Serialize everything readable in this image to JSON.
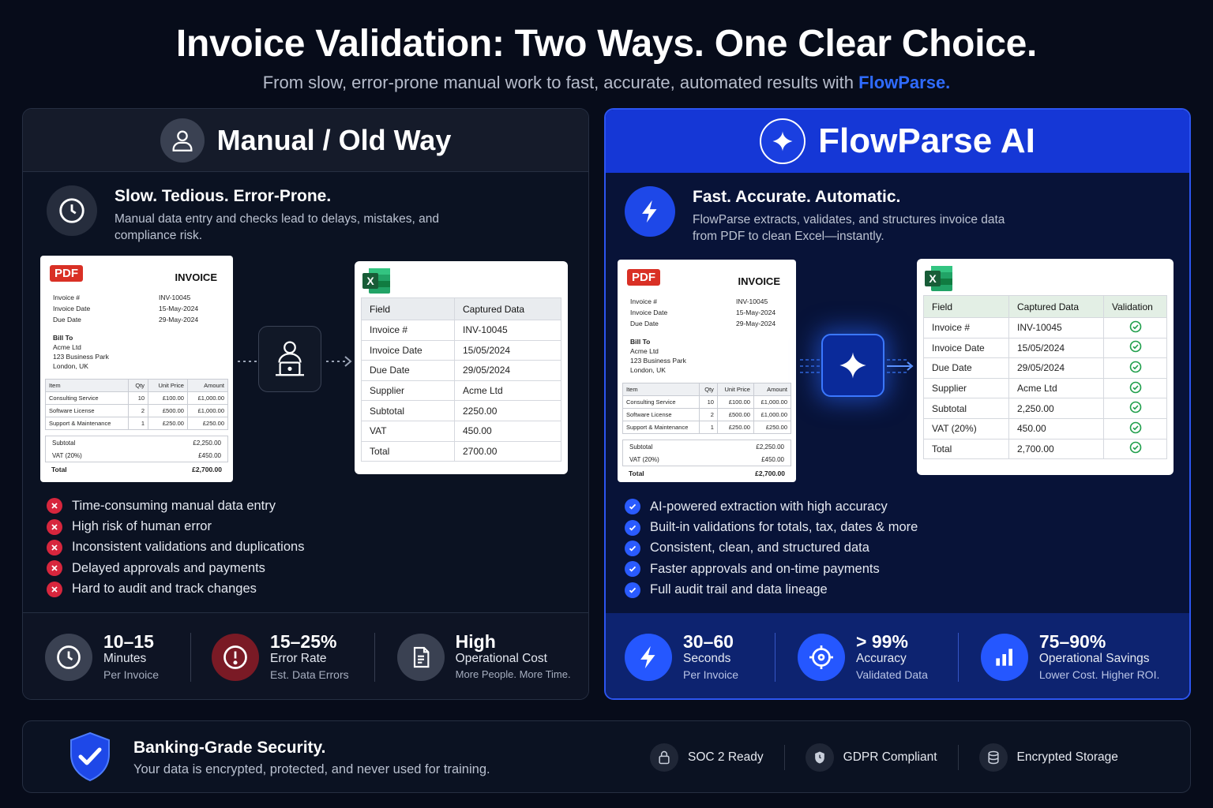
{
  "header": {
    "title": "Invoice Validation: Two Ways. One Clear Choice.",
    "subtitle_prefix": "From slow, error-prone manual work to fast, accurate, automated results with",
    "subtitle_brand": "FlowParse."
  },
  "colors": {
    "background": "#070c1a",
    "brand_blue": "#2f6bff",
    "ai_header": "#1537d6",
    "error_red": "#d7263d",
    "check_green": "#1e9e4a"
  },
  "manual": {
    "title": "Manual / Old Way",
    "header_icon": "user-icon",
    "intro_icon": "clock-icon",
    "intro_title": "Slow. Tedious. Error-Prone.",
    "intro_text": "Manual data entry and checks lead to delays, mistakes, and compliance risk.",
    "process_icon": "person-laptop-icon",
    "excel": {
      "headers": [
        "Field",
        "Captured Data"
      ],
      "rows": [
        [
          "Invoice #",
          "INV-10045"
        ],
        [
          "Invoice Date",
          "15/05/2024"
        ],
        [
          "Due Date",
          "29/05/2024"
        ],
        [
          "Supplier",
          "Acme Ltd"
        ],
        [
          "Subtotal",
          "2250.00"
        ],
        [
          "VAT",
          "450.00"
        ],
        [
          "Total",
          "2700.00"
        ]
      ]
    },
    "bullets": [
      "Time-consuming manual data entry",
      "High risk of human error",
      "Inconsistent validations and duplications",
      "Delayed approvals and payments",
      "Hard to audit and track changes"
    ],
    "stats": [
      {
        "icon": "clock-icon",
        "big": "10–15",
        "mid": "Minutes",
        "small": "Per Invoice"
      },
      {
        "icon": "alert-icon",
        "big": "15–25%",
        "mid": "Error Rate",
        "small": "Est. Data Errors"
      },
      {
        "icon": "document-icon",
        "big": "High",
        "mid": "Operational Cost",
        "small": "More People. More Time."
      }
    ]
  },
  "ai": {
    "title": "FlowParse AI",
    "header_icon": "sparkle-icon",
    "intro_icon": "lightning-icon",
    "intro_title": "Fast. Accurate. Automatic.",
    "intro_text": "FlowParse extracts, validates, and structures invoice data from PDF to clean Excel—instantly.",
    "process_icon": "sparkle-icon",
    "excel": {
      "headers": [
        "Field",
        "Captured Data",
        "Validation"
      ],
      "rows": [
        [
          "Invoice #",
          "INV-10045"
        ],
        [
          "Invoice Date",
          "15/05/2024"
        ],
        [
          "Due Date",
          "29/05/2024"
        ],
        [
          "Supplier",
          "Acme Ltd"
        ],
        [
          "Subtotal",
          "2,250.00"
        ],
        [
          "VAT (20%)",
          "450.00"
        ],
        [
          "Total",
          "2,700.00"
        ]
      ]
    },
    "bullets": [
      "AI-powered extraction with high accuracy",
      "Built-in validations for totals, tax, dates & more",
      "Consistent, clean, and structured data",
      "Faster approvals and on-time payments",
      "Full audit trail and data lineage"
    ],
    "stats": [
      {
        "icon": "lightning-icon",
        "big": "30–60",
        "mid": "Seconds",
        "small": "Per Invoice"
      },
      {
        "icon": "target-icon",
        "big": "> 99%",
        "mid": "Accuracy",
        "small": "Validated Data"
      },
      {
        "icon": "bar-chart-icon",
        "big": "75–90%",
        "mid": "Operational Savings",
        "small": "Lower Cost. Higher ROI."
      }
    ]
  },
  "invoice": {
    "badge": "PDF",
    "title": "INVOICE",
    "meta_labels": [
      "Invoice #",
      "Invoice Date",
      "Due Date"
    ],
    "meta_values": [
      "INV-10045",
      "15-May-2024",
      "29-May-2024"
    ],
    "bill_to_label": "Bill To",
    "bill_to_lines": [
      "Acme Ltd",
      "123 Business Park",
      "London, UK"
    ],
    "table_headers": [
      "Item",
      "Qty",
      "Unit Price",
      "Amount"
    ],
    "items": [
      [
        "Consulting Service",
        "10",
        "£100.00",
        "£1,000.00"
      ],
      [
        "Software License",
        "2",
        "£500.00",
        "£1,000.00"
      ],
      [
        "Support & Maintenance",
        "1",
        "£250.00",
        "£250.00"
      ]
    ],
    "subtotal_label": "Subtotal",
    "subtotal_value": "£2,250.00",
    "vat_label": "VAT (20%)",
    "vat_value": "£450.00",
    "total_label": "Total",
    "total_value": "£2,700.00"
  },
  "security": {
    "title": "Banking-Grade Security.",
    "text": "Your data is encrypted, protected, and never used for training.",
    "icon": "shield-check-icon",
    "badges": [
      {
        "icon": "lock-icon",
        "label": "SOC 2 Ready"
      },
      {
        "icon": "shield-icon",
        "label": "GDPR Compliant"
      },
      {
        "icon": "database-icon",
        "label": "Encrypted Storage"
      }
    ]
  }
}
